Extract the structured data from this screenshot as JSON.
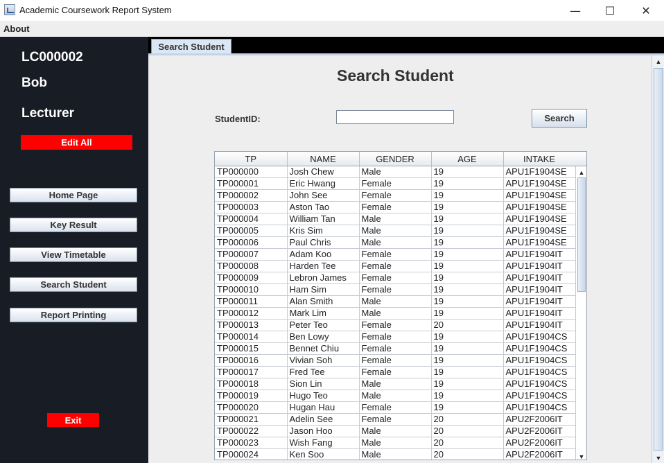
{
  "window": {
    "title": "Academic Coursework Report System",
    "minimize_glyph": "—",
    "maximize_glyph": "☐",
    "close_glyph": "✕"
  },
  "menu": {
    "about": "About"
  },
  "user": {
    "id": "LC000002",
    "name": "Bob",
    "role": "Lecturer"
  },
  "sidebar": {
    "edit_all": "Edit All",
    "nav": [
      "Home Page",
      "Key Result",
      "View Timetable",
      "Search Student",
      "Report Printing"
    ],
    "exit": "Exit"
  },
  "tab": {
    "label": "Search Student"
  },
  "search": {
    "title": "Search Student",
    "label": "StudentID:",
    "value": "",
    "button": "Search"
  },
  "table": {
    "headers": [
      "TP",
      "NAME",
      "GENDER",
      "AGE",
      "INTAKE"
    ],
    "rows": [
      [
        "TP000000",
        "Josh Chew",
        "Male",
        "19",
        "APU1F1904SE"
      ],
      [
        "TP000001",
        "Eric Hwang",
        "Female",
        "19",
        "APU1F1904SE"
      ],
      [
        "TP000002",
        "John See",
        "Female",
        "19",
        "APU1F1904SE"
      ],
      [
        "TP000003",
        "Aston Tao",
        "Female",
        "19",
        "APU1F1904SE"
      ],
      [
        "TP000004",
        "William Tan",
        "Male",
        "19",
        "APU1F1904SE"
      ],
      [
        "TP000005",
        "Kris Sim",
        "Male",
        "19",
        "APU1F1904SE"
      ],
      [
        "TP000006",
        "Paul Chris",
        "Male",
        "19",
        "APU1F1904SE"
      ],
      [
        "TP000007",
        "Adam Koo",
        "Female",
        "19",
        "APU1F1904IT"
      ],
      [
        "TP000008",
        "Harden Tee",
        "Female",
        "19",
        "APU1F1904IT"
      ],
      [
        "TP000009",
        "Lebron James",
        "Female",
        "19",
        "APU1F1904IT"
      ],
      [
        "TP000010",
        "Ham Sim",
        "Female",
        "19",
        "APU1F1904IT"
      ],
      [
        "TP000011",
        "Alan Smith",
        "Male",
        "19",
        "APU1F1904IT"
      ],
      [
        "TP000012",
        "Mark Lim",
        "Male",
        "19",
        "APU1F1904IT"
      ],
      [
        "TP000013",
        "Peter Teo",
        "Female",
        "20",
        "APU1F1904IT"
      ],
      [
        "TP000014",
        "Ben Lowy",
        "Female",
        "19",
        "APU1F1904CS"
      ],
      [
        "TP000015",
        "Bennet Chiu",
        "Female",
        "19",
        "APU1F1904CS"
      ],
      [
        "TP000016",
        "Vivian Soh",
        "Female",
        "19",
        "APU1F1904CS"
      ],
      [
        "TP000017",
        "Fred Tee",
        "Female",
        "19",
        "APU1F1904CS"
      ],
      [
        "TP000018",
        "Sion Lin",
        "Male",
        "19",
        "APU1F1904CS"
      ],
      [
        "TP000019",
        "Hugo Teo",
        "Male",
        "19",
        "APU1F1904CS"
      ],
      [
        "TP000020",
        "Hugan Hau",
        "Female",
        "19",
        "APU1F1904CS"
      ],
      [
        "TP000021",
        "Adelin See",
        "Female",
        "20",
        "APU2F2006IT"
      ],
      [
        "TP000022",
        "Jason Hoo",
        "Male",
        "20",
        "APU2F2006IT"
      ],
      [
        "TP000023",
        "Wish Fang",
        "Male",
        "20",
        "APU2F2006IT"
      ],
      [
        "TP000024",
        "Ken Soo",
        "Male",
        "20",
        "APU2F2006IT"
      ]
    ]
  },
  "icons": {
    "scroll_up": "▲",
    "scroll_down": "▼",
    "app_icon": "java-cup-icon"
  },
  "colors": {
    "sidebar_bg": "#181c25",
    "accent_red": "#ff0000",
    "tab_strip": "#000000",
    "content_bg": "#eeeeee"
  }
}
